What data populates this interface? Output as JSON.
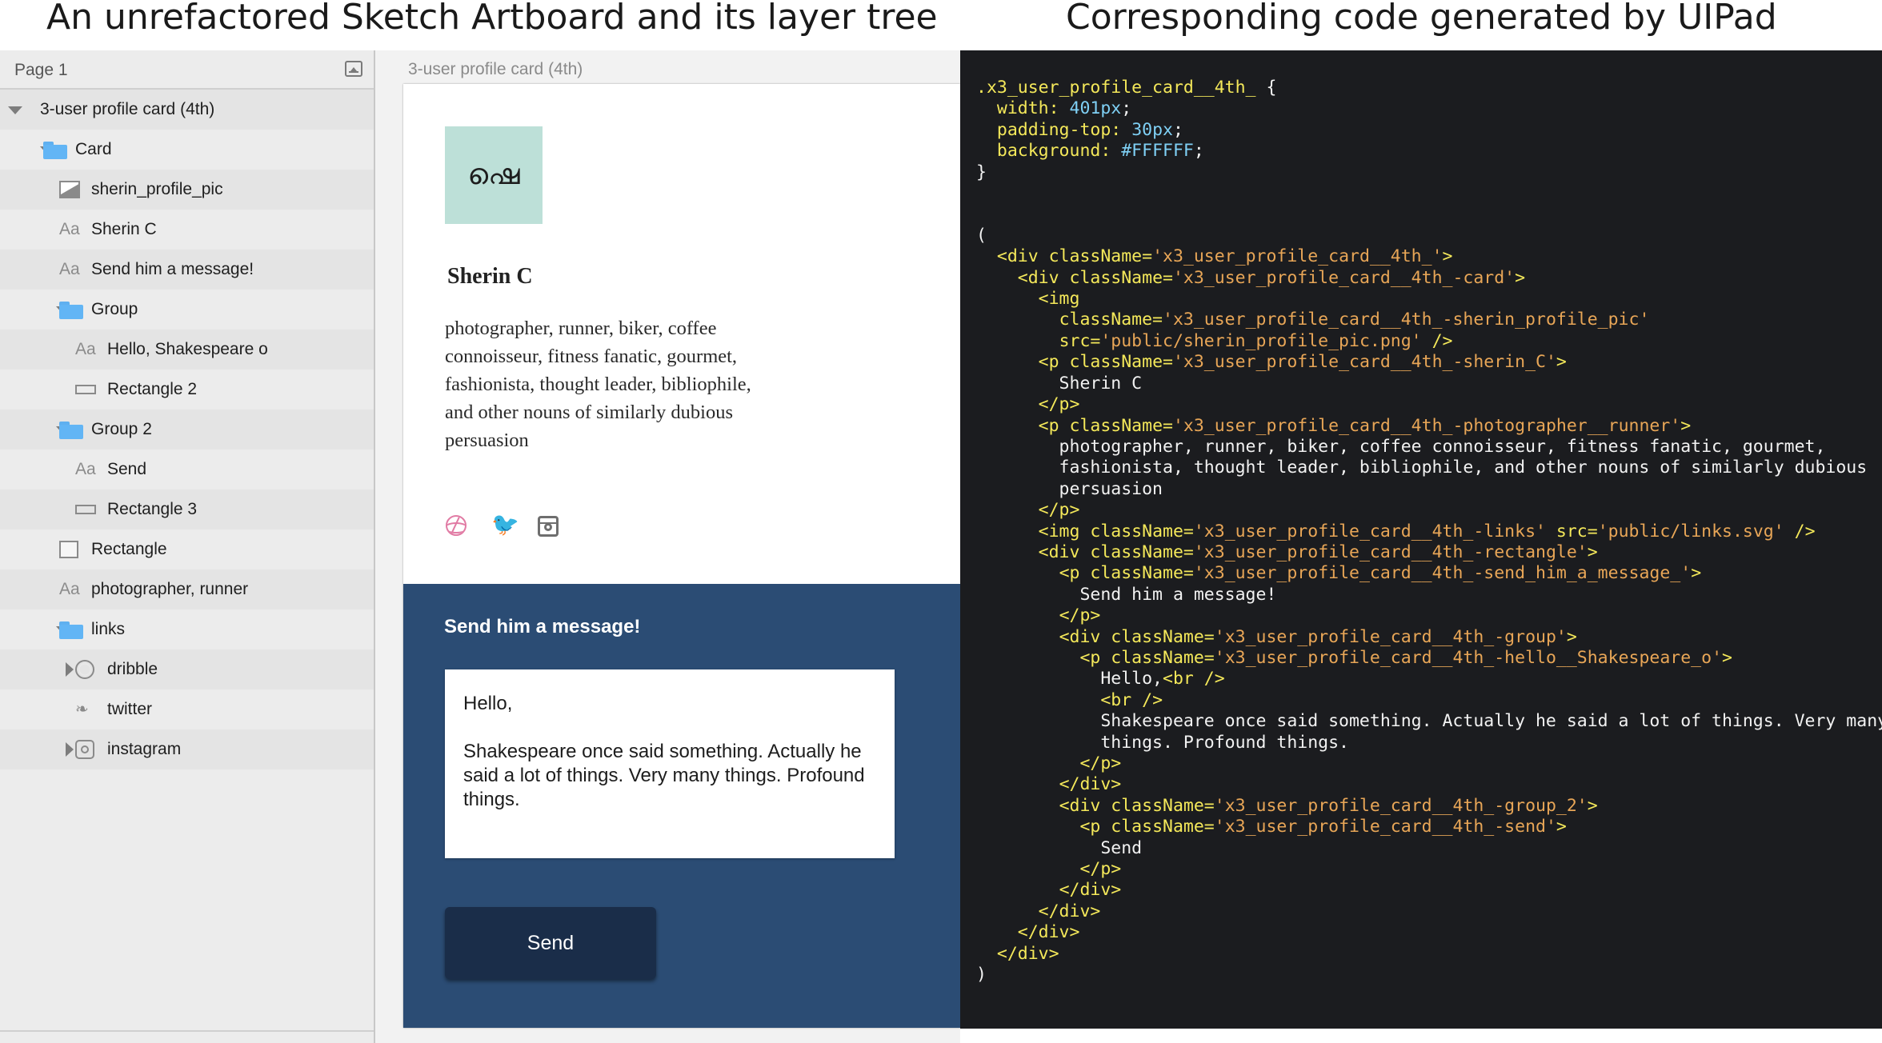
{
  "captions": {
    "left": "An unrefactored Sketch Artboard and its layer tree",
    "right": "Corresponding code generated by UIPad"
  },
  "layers": {
    "page_label": "Page 1",
    "items": [
      {
        "label": "3-user profile card (4th)",
        "icon": "triangle-down",
        "depth": 0
      },
      {
        "label": "Card",
        "icon": "folder-icon",
        "depth": 1
      },
      {
        "label": "sherin_profile_pic",
        "icon": "image-icon",
        "depth": 2
      },
      {
        "label": "Sherin C",
        "icon": "text-icon",
        "depth": 2
      },
      {
        "label": "Send him a message!",
        "icon": "text-icon",
        "depth": 2
      },
      {
        "label": "Group",
        "icon": "folder-icon",
        "depth": 2
      },
      {
        "label": "Hello, Shakespeare o",
        "icon": "text-icon",
        "depth": 3
      },
      {
        "label": "Rectangle 2",
        "icon": "rectangle-icon",
        "depth": 3
      },
      {
        "label": "Group 2",
        "icon": "folder-icon",
        "depth": 2
      },
      {
        "label": "Send",
        "icon": "text-icon",
        "depth": 3
      },
      {
        "label": "Rectangle 3",
        "icon": "rectangle-icon",
        "depth": 3
      },
      {
        "label": "Rectangle",
        "icon": "rectangle-icon",
        "depth": 2
      },
      {
        "label": "photographer, runner",
        "icon": "text-icon",
        "depth": 2
      },
      {
        "label": "links",
        "icon": "folder-icon",
        "depth": 2
      },
      {
        "label": "dribble",
        "icon": "dribbble-icon",
        "depth": 3
      },
      {
        "label": "twitter",
        "icon": "twitter-icon",
        "depth": 3
      },
      {
        "label": "instagram",
        "icon": "instagram-icon",
        "depth": 3
      }
    ],
    "text_icon_glyph": "Aa"
  },
  "canvas": {
    "artboard_title": "3-user profile card (4th)",
    "profile_pic_text": "ഷെ",
    "name": "Sherin C",
    "bio": "photographer, runner, biker, coffee connoisseur, fitness fanatic, gourmet, fashionista, thought leader, bibliophile, and other nouns of similarly dubious persuasion",
    "twitter_glyph": "🐦",
    "message_title": "Send him a message!",
    "message_line1": "Hello,",
    "message_line2": "Shakespeare once said something. Actually he said a lot of things. Very many things. Profound things.",
    "send_label": "Send",
    "colors": {
      "profile_pic_bg": "#bde0d8",
      "message_bg": "#2b4c74",
      "send_bg": "#1a2d49",
      "dribbble": "#e17ba4"
    }
  },
  "code": {
    "lines": [
      ".x3_user_profile_card__4th_ {",
      "  width: 401px;",
      "  padding-top: 30px;",
      "  background: #FFFFFF;",
      "}",
      "",
      "",
      "(",
      "  <div className='x3_user_profile_card__4th_'>",
      "    <div className='x3_user_profile_card__4th_-card'>",
      "      <img",
      "        className='x3_user_profile_card__4th_-sherin_profile_pic'",
      "        src='public/sherin_profile_pic.png' />",
      "      <p className='x3_user_profile_card__4th_-sherin_C'>",
      "        Sherin C",
      "      </p>",
      "      <p className='x3_user_profile_card__4th_-photographer__runner'>",
      "        photographer, runner, biker, coffee connoisseur, fitness fanatic, gourmet,",
      "        fashionista, thought leader, bibliophile, and other nouns of similarly dubious",
      "        persuasion",
      "      </p>",
      "      <img className='x3_user_profile_card__4th_-links' src='public/links.svg' />",
      "      <div className='x3_user_profile_card__4th_-rectangle'>",
      "        <p className='x3_user_profile_card__4th_-send_him_a_message_'>",
      "          Send him a message!",
      "        </p>",
      "        <div className='x3_user_profile_card__4th_-group'>",
      "          <p className='x3_user_profile_card__4th_-hello__Shakespeare_o'>",
      "            Hello,<br />",
      "            <br />",
      "            Shakespeare once said something. Actually he said a lot of things. Very many",
      "            things. Profound things.",
      "          </p>",
      "        </div>",
      "        <div className='x3_user_profile_card__4th_-group_2'>",
      "          <p className='x3_user_profile_card__4th_-send'>",
      "            Send",
      "          </p>",
      "        </div>",
      "      </div>",
      "    </div>",
      "  </div>",
      ")"
    ]
  }
}
